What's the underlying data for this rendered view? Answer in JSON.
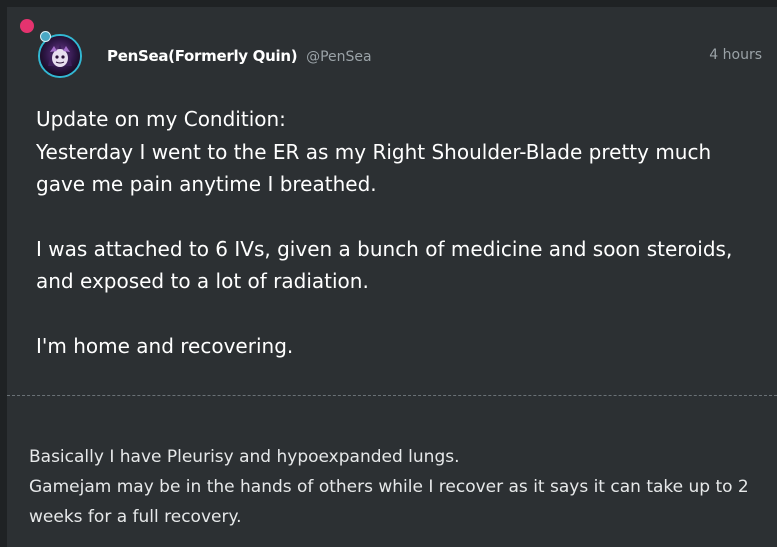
{
  "post": {
    "author_name": "PenSea(Formerly Quin)",
    "author_handle": "@PenSea",
    "timestamp": "4 hours",
    "body": [
      "Update on my Condition:",
      "Yesterday I went to the ER as my Right Shoulder-Blade pretty much gave me pain anytime I breathed.",
      "I was attached to 6 IVs, given a bunch of medicine and soon steroids, and exposed to a lot of radiation.",
      "I'm home and recovering."
    ],
    "note": [
      "Basically I have Pleurisy and hypoexpanded lungs.",
      "Gamejam may be in the hands of others while I recover as it says it can take up to 2 weeks for a full recovery."
    ]
  },
  "colors": {
    "background": "#1f2224",
    "card": "#2c3033",
    "unread_dot": "#e5336f",
    "avatar_ring": "#32b8d3",
    "muted_text": "#9aa2a7"
  },
  "icons": {
    "unread": "unread-dot-icon",
    "avatar": "user-avatar"
  }
}
